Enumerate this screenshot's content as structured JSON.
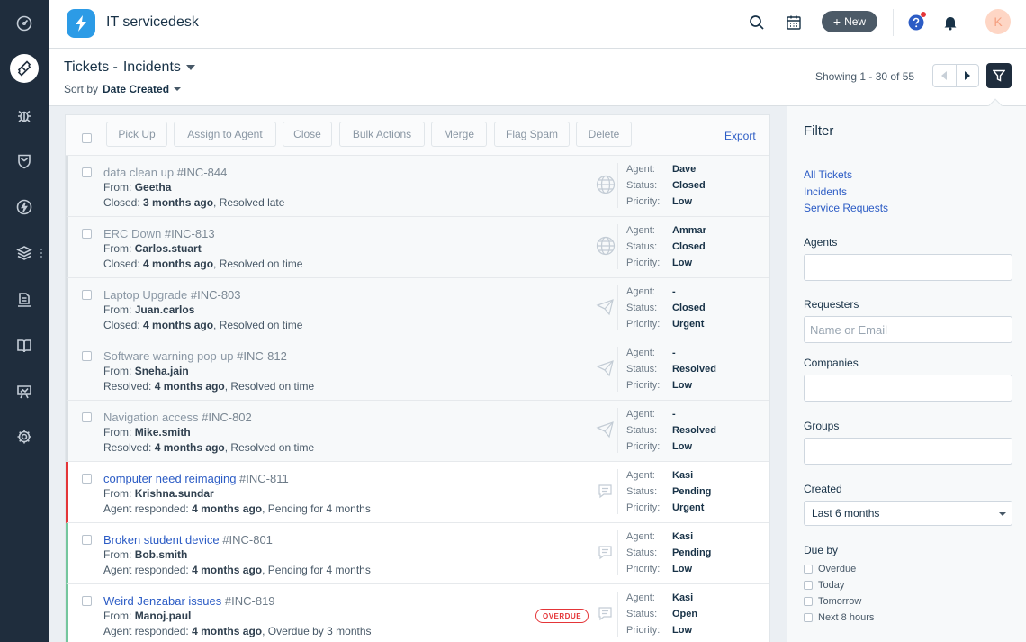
{
  "header": {
    "app_title": "IT servicedesk",
    "new_label": "New",
    "avatar_initial": "K"
  },
  "subheader": {
    "view_prefix": "Tickets -",
    "view_name": "Incidents",
    "sort_prefix": "Sort by",
    "sort_field": "Date Created",
    "showing": "Showing 1 - 30 of 55"
  },
  "toolbar": {
    "pick_up": "Pick Up",
    "assign": "Assign to Agent",
    "close": "Close",
    "bulk": "Bulk Actions",
    "merge": "Merge",
    "flag_spam": "Flag Spam",
    "delete": "Delete",
    "export": "Export"
  },
  "labels": {
    "from": "From:",
    "agent": "Agent:",
    "status": "Status:",
    "priority": "Priority:"
  },
  "tickets": [
    {
      "subject": "data clean up",
      "id": "#INC-844",
      "from": "Geetha",
      "meta_prefix": "Closed:",
      "meta_time": "3 months ago",
      "meta_suffix": ", Resolved late",
      "agent": "Dave",
      "status": "Closed",
      "priority": "Low",
      "source": "globe-icon",
      "state": "closed",
      "badge": ""
    },
    {
      "subject": "ERC Down",
      "id": "#INC-813",
      "from": "Carlos.stuart",
      "meta_prefix": "Closed:",
      "meta_time": "4 months ago",
      "meta_suffix": ", Resolved on time",
      "agent": "Ammar",
      "status": "Closed",
      "priority": "Low",
      "source": "globe-icon",
      "state": "closed",
      "badge": ""
    },
    {
      "subject": "Laptop Upgrade",
      "id": "#INC-803",
      "from": "Juan.carlos",
      "meta_prefix": "Closed:",
      "meta_time": "4 months ago",
      "meta_suffix": ", Resolved on time",
      "agent": "-",
      "status": "Closed",
      "priority": "Urgent",
      "source": "email-icon",
      "state": "closed",
      "badge": ""
    },
    {
      "subject": "Software warning pop-up",
      "id": "#INC-812",
      "from": "Sneha.jain",
      "meta_prefix": "Resolved:",
      "meta_time": "4 months ago",
      "meta_suffix": ", Resolved on time",
      "agent": "-",
      "status": "Resolved",
      "priority": "Low",
      "source": "email-icon",
      "state": "closed",
      "badge": ""
    },
    {
      "subject": "Navigation access",
      "id": "#INC-802",
      "from": "Mike.smith",
      "meta_prefix": "Resolved:",
      "meta_time": "4 months ago",
      "meta_suffix": ", Resolved on time",
      "agent": "-",
      "status": "Resolved",
      "priority": "Low",
      "source": "email-icon",
      "state": "closed",
      "badge": ""
    },
    {
      "subject": "computer need reimaging",
      "id": "#INC-811",
      "from": "Krishna.sundar",
      "meta_prefix": "Agent responded:",
      "meta_time": "4 months ago",
      "meta_suffix": ", Pending for 4 months",
      "agent": "Kasi",
      "status": "Pending",
      "priority": "Urgent",
      "source": "portal-icon",
      "state": "red",
      "badge": ""
    },
    {
      "subject": "Broken student device",
      "id": "#INC-801",
      "from": "Bob.smith",
      "meta_prefix": "Agent responded:",
      "meta_time": "4 months ago",
      "meta_suffix": ", Pending for 4 months",
      "agent": "Kasi",
      "status": "Pending",
      "priority": "Low",
      "source": "portal-icon",
      "state": "green",
      "badge": ""
    },
    {
      "subject": "Weird Jenzabar issues",
      "id": "#INC-819",
      "from": "Manoj.paul",
      "meta_prefix": "Agent responded:",
      "meta_time": "4 months ago",
      "meta_suffix": ", Overdue by 3 months",
      "agent": "Kasi",
      "status": "Open",
      "priority": "Low",
      "source": "portal-icon",
      "state": "green",
      "badge": "OVERDUE"
    }
  ],
  "filter": {
    "title": "Filter",
    "links": [
      "All Tickets",
      "Incidents",
      "Service Requests"
    ],
    "agents_label": "Agents",
    "requesters_label": "Requesters",
    "requesters_placeholder": "Name or Email",
    "companies_label": "Companies",
    "groups_label": "Groups",
    "created_label": "Created",
    "created_value": "Last 6 months",
    "dueby_label": "Due by",
    "dueby_options": [
      "Overdue",
      "Today",
      "Tomorrow",
      "Next 8 hours"
    ]
  }
}
